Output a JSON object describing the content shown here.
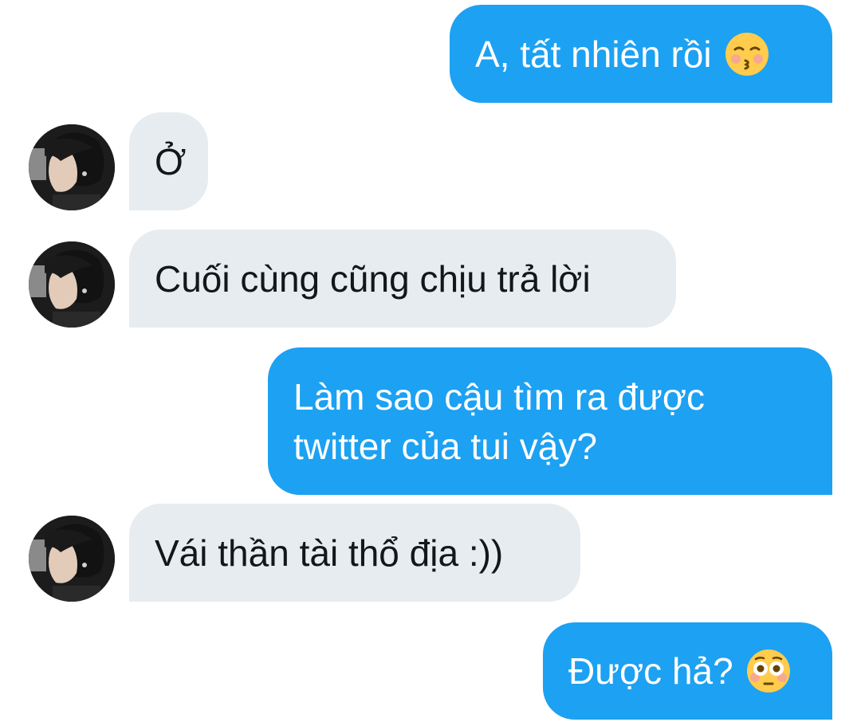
{
  "conversation": {
    "messages": [
      {
        "sender": "me",
        "text": "A, tất nhiên rồi",
        "emoji": "kissing-face-with-closed-eyes-icon"
      },
      {
        "sender": "other",
        "text": "Ở"
      },
      {
        "sender": "other",
        "text": "Cuối cùng cũng chịu trả lời"
      },
      {
        "sender": "me",
        "text": "Làm sao cậu tìm ra được\ntwitter của tui vậy?"
      },
      {
        "sender": "other",
        "text": "Vái thần tài thổ địa :))"
      },
      {
        "sender": "me",
        "text": "Được hả?",
        "emoji": "flushed-face-icon"
      }
    ]
  },
  "colors": {
    "outgoing_bubble": "#1da1f2",
    "incoming_bubble": "#e6ecf0",
    "outgoing_text": "#ffffff",
    "incoming_text": "#14171a"
  }
}
